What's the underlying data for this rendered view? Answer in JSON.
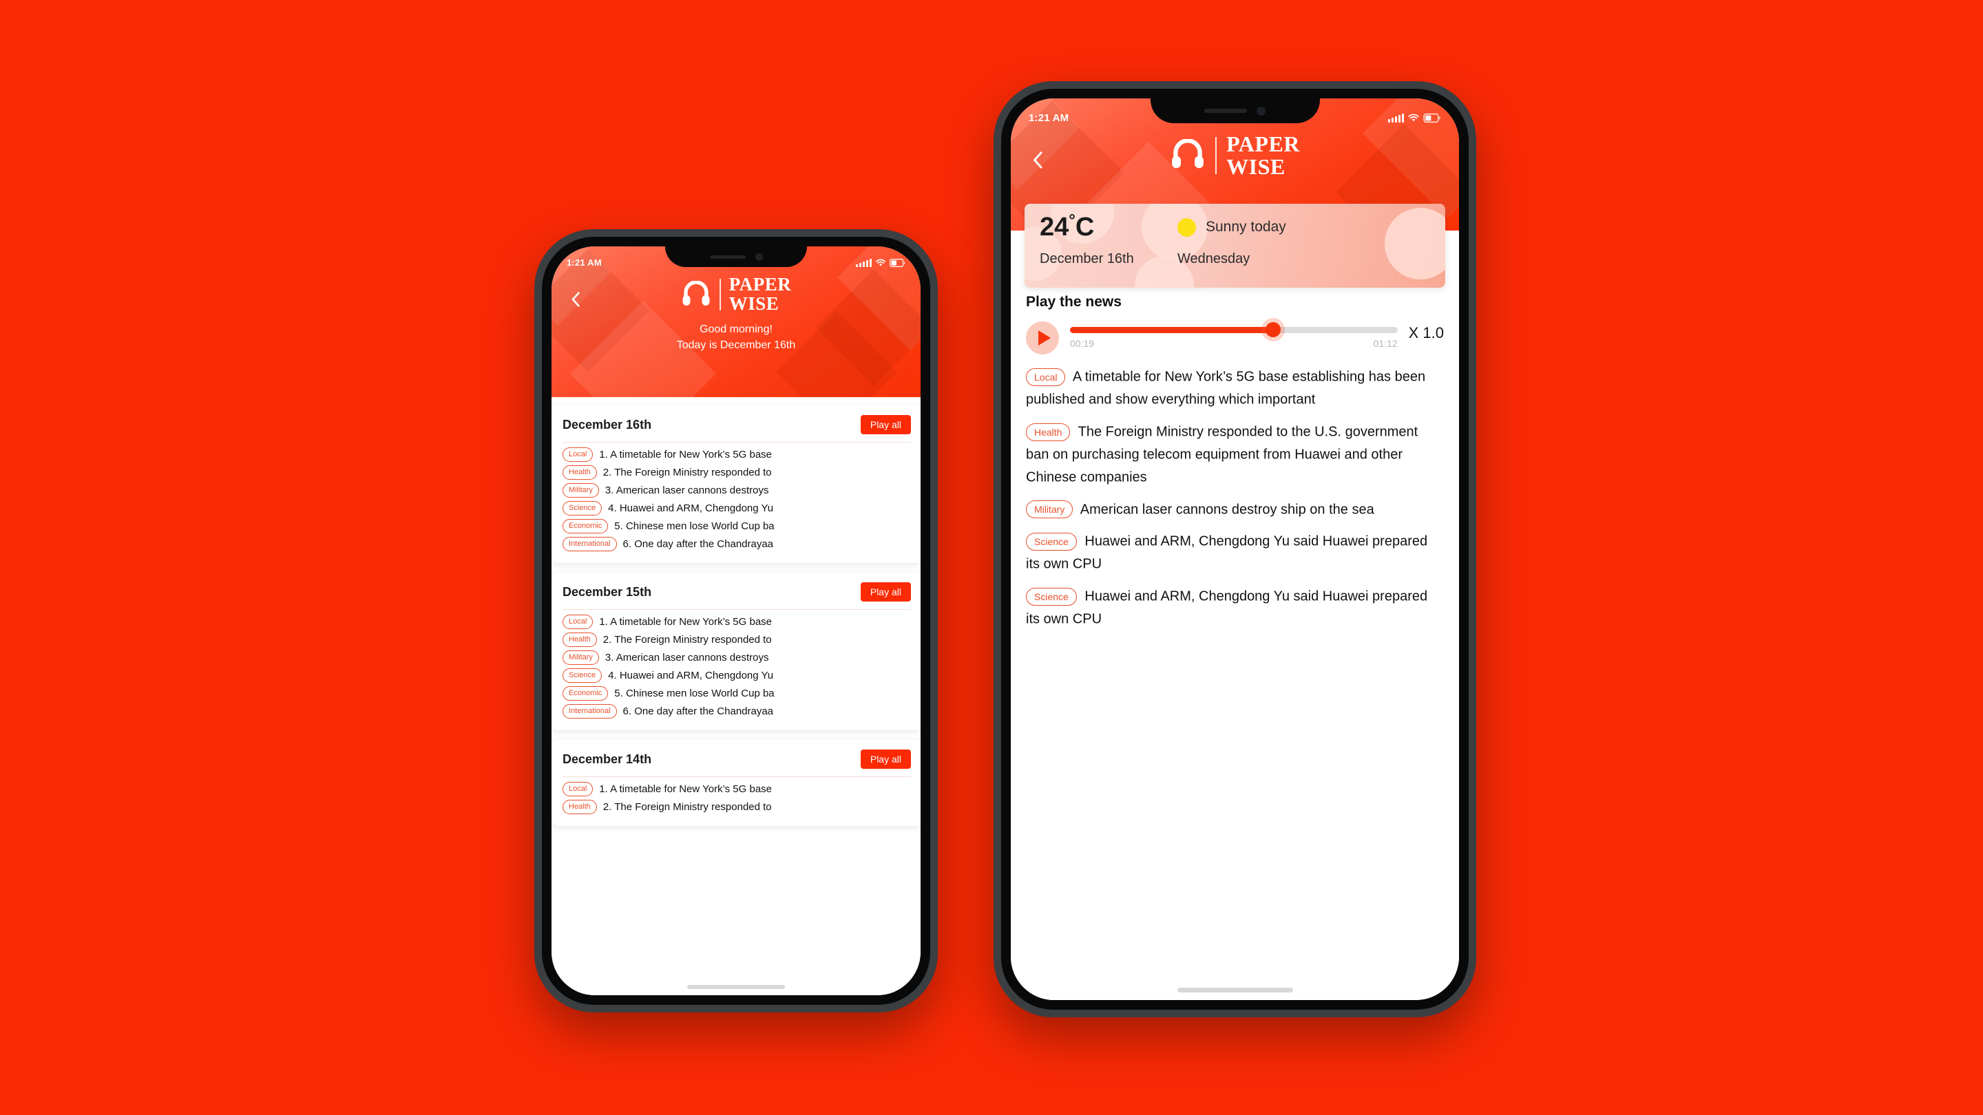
{
  "background_color": "#FA2A05",
  "brand": {
    "name_line1": "PAPER",
    "name_line2": "WISE",
    "logo_icon": "headphones-icon"
  },
  "status_bar": {
    "time": "1:21 AM",
    "signal_icon": "signal-bars-icon",
    "wifi_icon": "wifi-icon",
    "battery_icon": "battery-icon"
  },
  "left_phone": {
    "back_icon": "chevron-left-icon",
    "greeting_line1": "Good morning!",
    "greeting_line2": "Today is December 16th",
    "play_all_label": "Play all",
    "day_cards": [
      {
        "date": "December 16th",
        "items": [
          {
            "tag": "Local",
            "text": "1. A timetable for New York’s 5G base"
          },
          {
            "tag": "Health",
            "text": "2. The Foreign Ministry responded to"
          },
          {
            "tag": "Military",
            "text": "3. American laser cannons destroys"
          },
          {
            "tag": "Science",
            "text": "4. Huawei and ARM, Chengdong Yu"
          },
          {
            "tag": "Economic",
            "text": "5. Chinese men lose World Cup ba"
          },
          {
            "tag": "International",
            "text": "6. One day after the Chandrayaa"
          }
        ]
      },
      {
        "date": "December 15th",
        "items": [
          {
            "tag": "Local",
            "text": "1. A timetable for New York’s 5G base"
          },
          {
            "tag": "Health",
            "text": "2. The Foreign Ministry responded to"
          },
          {
            "tag": "Military",
            "text": "3. American laser cannons destroys"
          },
          {
            "tag": "Science",
            "text": "4. Huawei and ARM, Chengdong Yu"
          },
          {
            "tag": "Economic",
            "text": "5. Chinese men lose World Cup ba"
          },
          {
            "tag": "International",
            "text": "6. One day after the Chandrayaa"
          }
        ]
      },
      {
        "date": "December 14th",
        "items": [
          {
            "tag": "Local",
            "text": "1. A timetable for New York’s 5G base"
          },
          {
            "tag": "Health",
            "text": "2. The Foreign Ministry responded to"
          }
        ]
      }
    ]
  },
  "right_phone": {
    "back_icon": "chevron-left-icon",
    "weather": {
      "temperature": "24",
      "degree_symbol": "°",
      "unit": "C",
      "condition_icon": "sun-icon",
      "condition": "Sunny today",
      "date": "December 16th",
      "weekday": "Wednesday"
    },
    "player": {
      "section_title": "Play the news",
      "play_icon": "play-icon",
      "elapsed": "00:19",
      "duration": "01:12",
      "progress_percent": 62,
      "speed": "X 1.0"
    },
    "articles": [
      {
        "tag": "Local",
        "text": "A timetable for New York’s 5G base establishing has been published and show everything which important"
      },
      {
        "tag": "Health",
        "text": "The Foreign Ministry responded to the U.S. government ban on purchasing telecom equipment from Huawei and other Chinese companies"
      },
      {
        "tag": "Military",
        "text": "American laser cannons destroy ship on the sea"
      },
      {
        "tag": "Science",
        "text": "Huawei and ARM, Chengdong Yu said Huawei prepared its own CPU"
      },
      {
        "tag": "Science",
        "text": "Huawei and ARM, Chengdong Yu said Huawei prepared its own CPU"
      }
    ]
  },
  "colors": {
    "brand_red": "#FA2A05",
    "tag_red": "#E8502C",
    "sun_yellow": "#FCE116",
    "weather_card_pink": "#FBD6CE"
  }
}
